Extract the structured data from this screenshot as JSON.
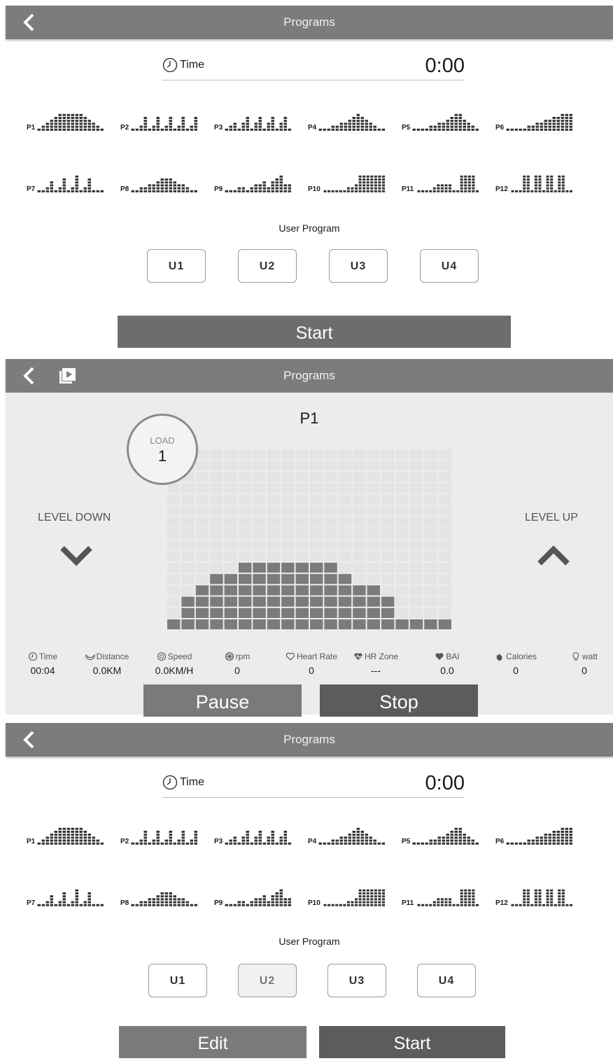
{
  "screens": [
    {
      "header": {
        "title": "Programs"
      },
      "time": {
        "label": "Time",
        "value": "0:00"
      },
      "programs": [
        "P1",
        "P2",
        "P3",
        "P4",
        "P5",
        "P6",
        "P7",
        "P8",
        "P9",
        "P10",
        "P11",
        "P12"
      ],
      "user_program": {
        "label": "User Program",
        "buttons": [
          "U1",
          "U2",
          "U3",
          "U4"
        ]
      },
      "start_label": "Start"
    },
    {
      "header": {
        "title": "Programs"
      },
      "program_name": "P1",
      "load": {
        "label": "LOAD",
        "value": "1"
      },
      "level_down_label": "LEVEL DOWN",
      "level_up_label": "LEVEL UP",
      "profile_levels": [
        1,
        3,
        4,
        5,
        5,
        6,
        6,
        6,
        6,
        6,
        6,
        6,
        5,
        4,
        4,
        3,
        1,
        1,
        1,
        1
      ],
      "stats": [
        {
          "label": "Time",
          "icon": "clock-icon",
          "value": "00:04"
        },
        {
          "label": "Distance",
          "icon": "distance-icon",
          "value": "0.0KM"
        },
        {
          "label": "Speed",
          "icon": "speed-icon",
          "value": "0.0KM/H"
        },
        {
          "label": "rpm",
          "icon": "rpm-icon",
          "value": "0"
        },
        {
          "label": "Heart Rate",
          "icon": "heart-icon",
          "value": "0"
        },
        {
          "label": "HR Zone",
          "icon": "hr-zone-icon",
          "value": "---"
        },
        {
          "label": "BAI",
          "icon": "bai-icon",
          "value": "0.0"
        },
        {
          "label": "Calories",
          "icon": "calories-icon",
          "value": "0"
        },
        {
          "label": "watt",
          "icon": "watt-icon",
          "value": "0"
        }
      ],
      "pause_label": "Pause",
      "stop_label": "Stop"
    },
    {
      "header": {
        "title": "Programs"
      },
      "time": {
        "label": "Time",
        "value": "0:00"
      },
      "programs": [
        "P1",
        "P2",
        "P3",
        "P4",
        "P5",
        "P6",
        "P7",
        "P8",
        "P9",
        "P10",
        "P11",
        "P12"
      ],
      "user_program": {
        "label": "User Program",
        "buttons": [
          "U1",
          "U2",
          "U3",
          "U4"
        ],
        "selected": "U2"
      },
      "edit_label": "Edit",
      "start_label": "Start"
    }
  ]
}
